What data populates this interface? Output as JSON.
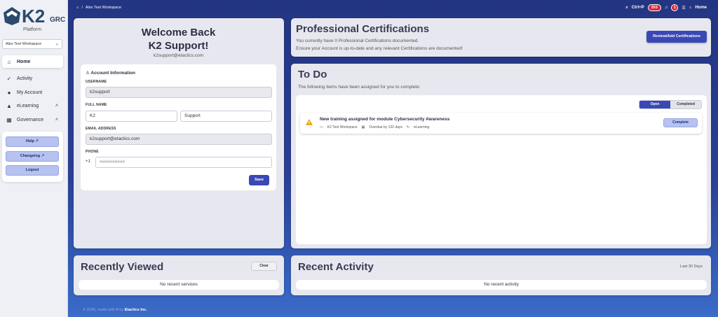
{
  "sidebar": {
    "logo_text": "K2 GRC",
    "platform_label": "Platform",
    "workspace": "Alex Test Workspace",
    "nav": [
      {
        "label": "Home"
      },
      {
        "label": "Activity"
      },
      {
        "label": "My Account"
      },
      {
        "label": "eLearning"
      },
      {
        "label": "Governance"
      }
    ],
    "help_label": "Help",
    "changelog_label": "Changelog",
    "logout_label": "Logout"
  },
  "topbar": {
    "breadcrumb_separator": "/",
    "breadcrumb": "Alex Test Workspace",
    "shortcut": "Ctrl+P",
    "alert_count": "203",
    "notification_count": "1",
    "home_label": "Home"
  },
  "welcome": {
    "line1": "Welcome Back",
    "line2": "K2 Support!",
    "email": "k2support@etactics.com",
    "section_title": "Account Information",
    "username_label": "USERNAME",
    "username": "k2support",
    "fullname_label": "FULL NAME",
    "first_name": "K2",
    "last_name": "Support",
    "email_label": "EMAIL ADDRESS",
    "email_value": "k2support@etactics.com",
    "phone_label": "PHONE",
    "phone_prefix": "+1",
    "phone_placeholder": "##########",
    "save_label": "Save"
  },
  "certifications": {
    "title": "Professional Certifications",
    "line1": "You currently have 0 Professional Certifications documented.",
    "line2": "Ensure your Account is up-to-date and any relevant Certifications are documented!",
    "button_label": "Review/Add Certifications"
  },
  "todo": {
    "title": "To Do",
    "subtitle": "The following items have been assigned for you to complete:",
    "tab_open": "Open",
    "tab_completed": "Completed",
    "items": [
      {
        "title": "New training assigned for module Cybersecurity Awareness",
        "workspace": "K2 Test Workspace",
        "due": "Overdue by 132 days",
        "category": "eLearning",
        "action_label": "Complete"
      }
    ]
  },
  "recently_viewed": {
    "title": "Recently Viewed",
    "clear_label": "Clear",
    "empty": "No recent services"
  },
  "recent_activity": {
    "title": "Recent Activity",
    "range": "Last 30 Days",
    "empty": "No recent activity"
  },
  "footer": {
    "prefix": "© 2026, made with",
    "by": "by",
    "brand": "Etactics Inc."
  },
  "colors": {
    "primary": "#3948b5",
    "danger": "#d9283b",
    "warning": "#f0a500"
  }
}
